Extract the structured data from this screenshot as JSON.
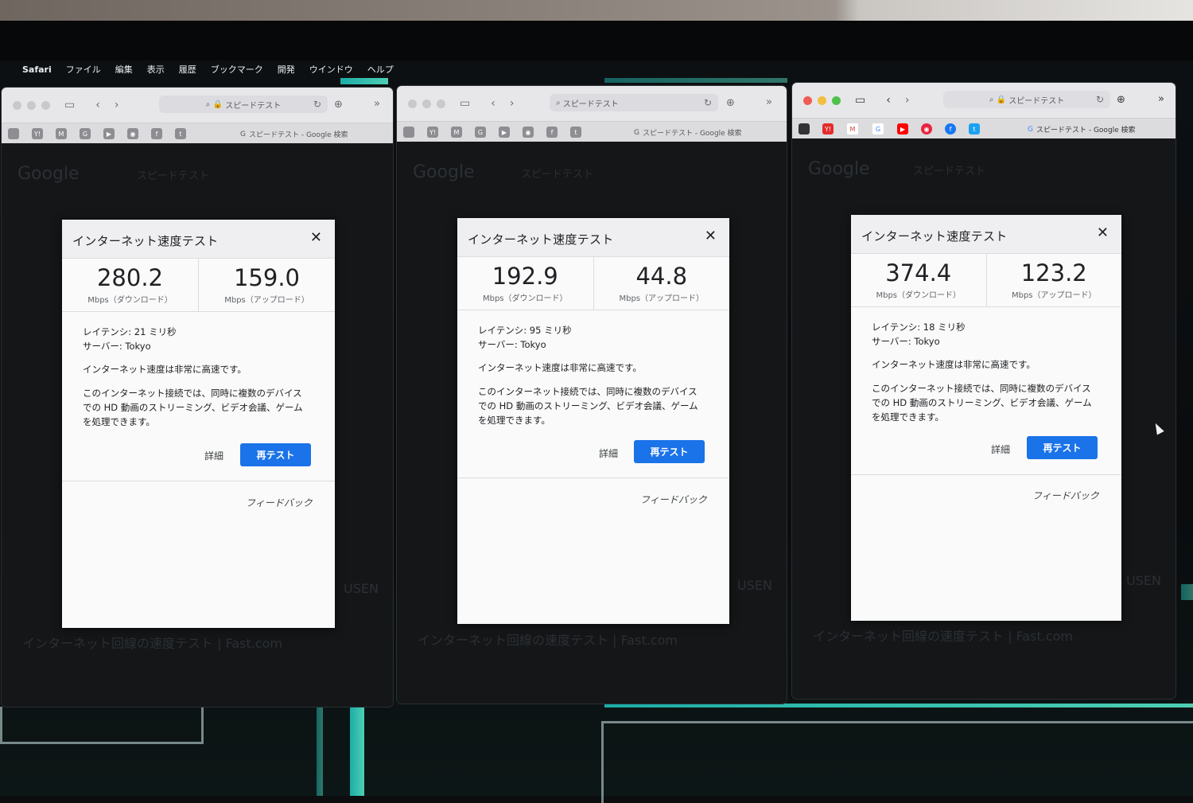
{
  "menubar": {
    "items": [
      "Safari",
      "ファイル",
      "編集",
      "表示",
      "履歴",
      "ブックマーク",
      "開発",
      "ウインドウ",
      "ヘルプ"
    ]
  },
  "browser": {
    "address_text": "スピードテスト",
    "tab_title": "スピードテスト - Google 検索",
    "bg_logo": "Google",
    "bg_query": "スピードテスト",
    "bg_result_title": "インターネット回線の速度テスト | Fast.com",
    "bg_result_brand": "USEN"
  },
  "dialog": {
    "title": "インターネット速度テスト",
    "download_unit": "Mbps（ダウンロード）",
    "upload_unit": "Mbps（アップロード）",
    "server_label": "サーバー: Tokyo",
    "status": "インターネット速度は非常に高速です。",
    "description_line1": "このインターネット接続では、同時に複数のデバイス",
    "description_line2": "での HD 動画のストリーミング、ビデオ会議、ゲーム",
    "description_line3": "を処理できます。",
    "details_label": "詳細",
    "retest_label": "再テスト",
    "feedback_label": "フィードバック"
  },
  "windows": [
    {
      "download": "280.2",
      "upload": "159.0",
      "latency": "レイテンシ: 21 ミリ秒"
    },
    {
      "download": "192.9",
      "upload": "44.8",
      "latency": "レイテンシ: 95 ミリ秒"
    },
    {
      "download": "374.4",
      "upload": "123.2",
      "latency": "レイテンシ: 18 ミリ秒"
    }
  ],
  "colors": {
    "accent": "#1a73e8",
    "dialog_bg": "#fafafa"
  }
}
